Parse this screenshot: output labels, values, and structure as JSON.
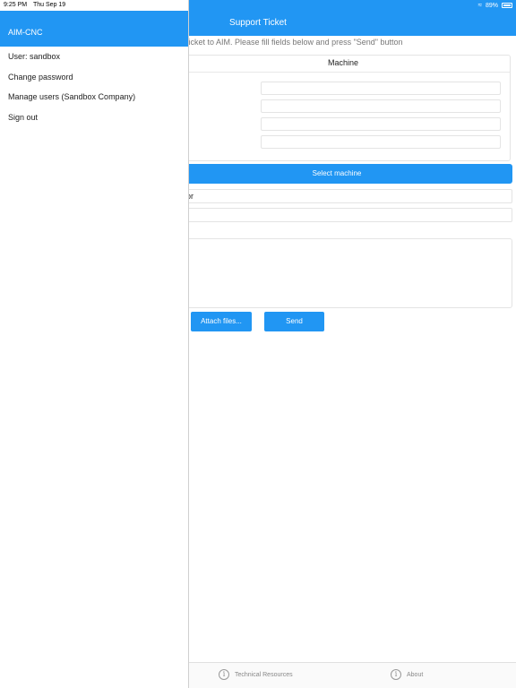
{
  "status_bar": {
    "time": "9:25 PM",
    "date": "Thu Sep 19",
    "battery": "89%"
  },
  "header": {
    "title": "Support Ticket"
  },
  "intro": {
    "text": "rt ticket to AIM. Please fill fields below and press \"Send\" button"
  },
  "machine": {
    "heading": "Machine",
    "field_count": 4
  },
  "buttons": {
    "select_machine": "Select machine",
    "attach_files": "Attach files...",
    "send": "Send"
  },
  "form": {
    "contractor_partial": "ctor"
  },
  "drawer": {
    "title": "AIM-CNC",
    "items": [
      {
        "label": "User: sandbox"
      },
      {
        "label": "Change password"
      },
      {
        "label": "Manage users (Sandbox Company)"
      },
      {
        "label": "Sign out"
      }
    ]
  },
  "bottom_bar": {
    "tabs": [
      {
        "label": "Technical Resources",
        "icon": "info-icon"
      },
      {
        "label": "About",
        "icon": "info-icon"
      }
    ]
  },
  "colors": {
    "accent": "#2196F3"
  }
}
